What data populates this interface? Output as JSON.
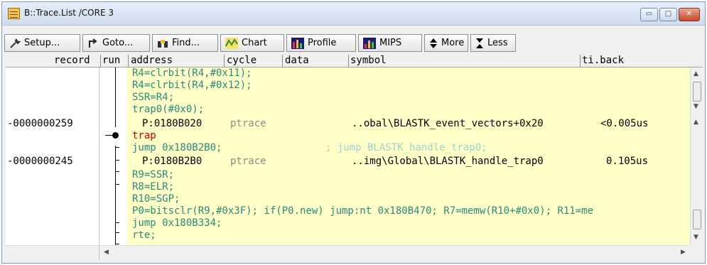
{
  "window": {
    "title": "B::Trace.List /CORE 3",
    "buttons": {
      "minimize": "▭",
      "maximize": "□",
      "close": "✕"
    }
  },
  "toolbar": {
    "setup_label": "Setup...",
    "goto_label": "Goto...",
    "find_label": "Find...",
    "chart_label": "Chart",
    "profile_label": "Profile",
    "mips_label": "MIPS",
    "more_label": "More",
    "less_label": "Less"
  },
  "columns": {
    "record": "record",
    "run": "run",
    "address": "address",
    "cycle": "cycle",
    "data": "data",
    "symbol": "symbol",
    "tiback": "ti.back"
  },
  "trace": {
    "asm1": "R4=clrbit(R4,#0x11);",
    "asm2": "R4=clrbit(R4,#0x12);",
    "asm3": "SSR=R4;",
    "asm4": "trap0(#0x0);",
    "rec1": "-0000000259",
    "entry1_addr": "P:0180B020",
    "entry1_cycle": "ptrace",
    "entry1_symbol": "..obal\\BLASTK_event_vectors+0x20",
    "entry1_tiback": "<0.005us",
    "trap": "trap",
    "jump1": "jump 0x180B2B0;",
    "jump1_comment": "; jump BLASTK_handle_trap0;",
    "rec2": "-0000000245",
    "entry2_addr": "P:0180B2B0",
    "entry2_cycle": "ptrace",
    "entry2_symbol": "..img\\Global\\BLASTK_handle_trap0",
    "entry2_tiback": "0.105us",
    "asm5": "R9=SSR;",
    "asm6": "R8=ELR;",
    "asm7": "R10=SGP;",
    "asm8": "P0=bitsclr(R9,#0x3F); if(P0.new) jump:nt 0x180B470; R7=memw(R10+#0x0); R11=me",
    "asm9": "jump 0x180B334;",
    "asm10": "rte;"
  },
  "scrollbar": {
    "up": "▲",
    "down": "▼",
    "left": "◀",
    "right": "▶"
  }
}
